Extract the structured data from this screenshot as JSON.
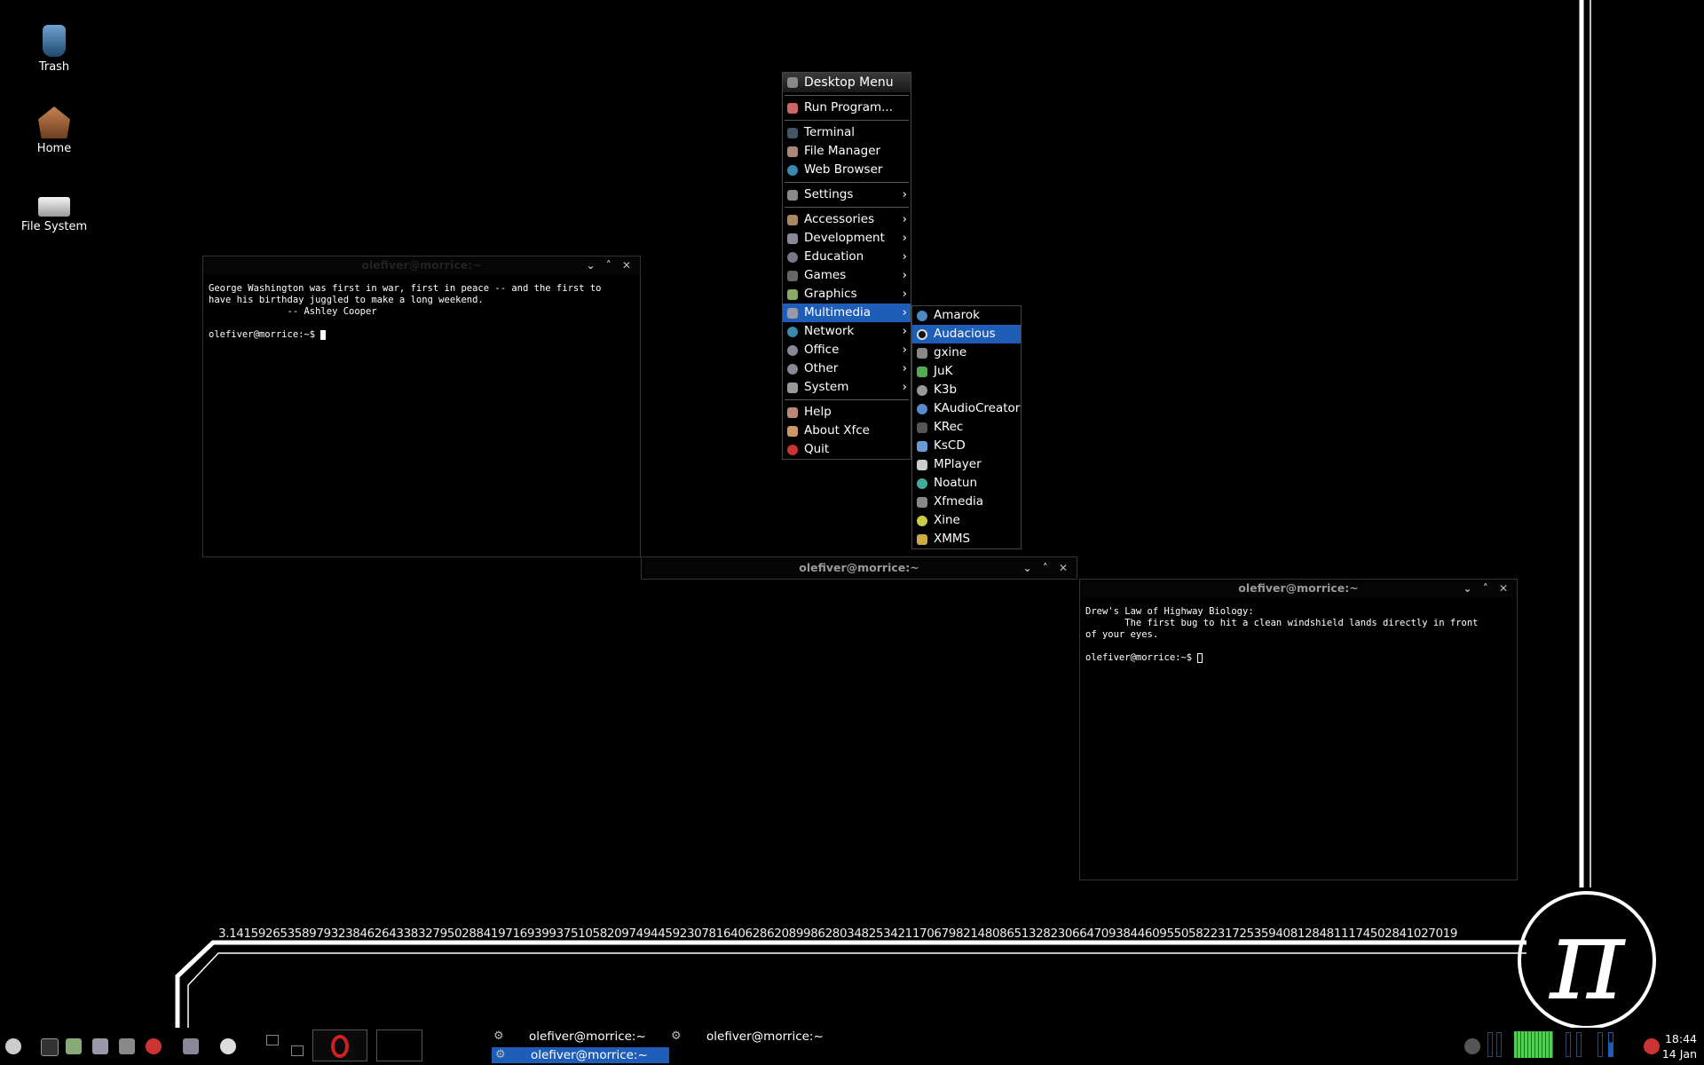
{
  "desktop": {
    "icons": [
      {
        "label": "Trash",
        "icon": "trash-icon"
      },
      {
        "label": "Home",
        "icon": "home-icon"
      },
      {
        "label": "File System",
        "icon": "drive-icon"
      }
    ],
    "pi_digits": "3.1415926535897932384626433832795028841971693993751058209749445923078164062862089986280348253421170679821480865132823066470938446095505822317253594081284811174502841027019",
    "pi_symbol": "π"
  },
  "terminals": {
    "left": {
      "title": "olefiver@morrice:~",
      "buttons": "⌄ ˄ ✕",
      "text": "George Washington was first in war, first in peace -- and the first to\nhave his birthday juggled to make a long weekend.\n              -- Ashley Cooper\n\nolefiver@morrice:~$ "
    },
    "middle": {
      "title": "olefiver@morrice:~",
      "buttons": "⌄ ˄ ✕"
    },
    "right": {
      "title": "olefiver@morrice:~",
      "buttons": "⌄ ˄ ✕",
      "text": "Drew's Law of Highway Biology:\n       The first bug to hit a clean windshield lands directly in front\nof your eyes.\n\nolefiver@morrice:~$ "
    }
  },
  "desktop_menu": {
    "header": "Desktop Menu",
    "group1": [
      "Run Program..."
    ],
    "group2": [
      "Terminal",
      "File Manager",
      "Web Browser"
    ],
    "group3": [
      "Settings"
    ],
    "group4": [
      "Accessories",
      "Development",
      "Education",
      "Games",
      "Graphics",
      "Multimedia",
      "Network",
      "Office",
      "Other",
      "System"
    ],
    "group5": [
      "Help",
      "About Xfce",
      "Quit"
    ],
    "arrow": "›"
  },
  "multimedia_menu": {
    "items": [
      "Amarok",
      "Audacious",
      "gxine",
      "JuK",
      "K3b",
      "KAudioCreator",
      "KRec",
      "KsCD",
      "MPlayer",
      "Noatun",
      "Xfmedia",
      "Xine",
      "XMMS"
    ],
    "selected": "Audacious"
  },
  "taskbar": {
    "tasks": [
      {
        "label": "olefiver@morrice:~"
      },
      {
        "label": "olefiver@morrice:~"
      },
      {
        "label": "olefiver@morrice:~"
      }
    ],
    "clock_time": "18:44",
    "clock_date": "14 Jan"
  },
  "colors": {
    "selection": "#1e5eb8",
    "background": "#000000"
  }
}
